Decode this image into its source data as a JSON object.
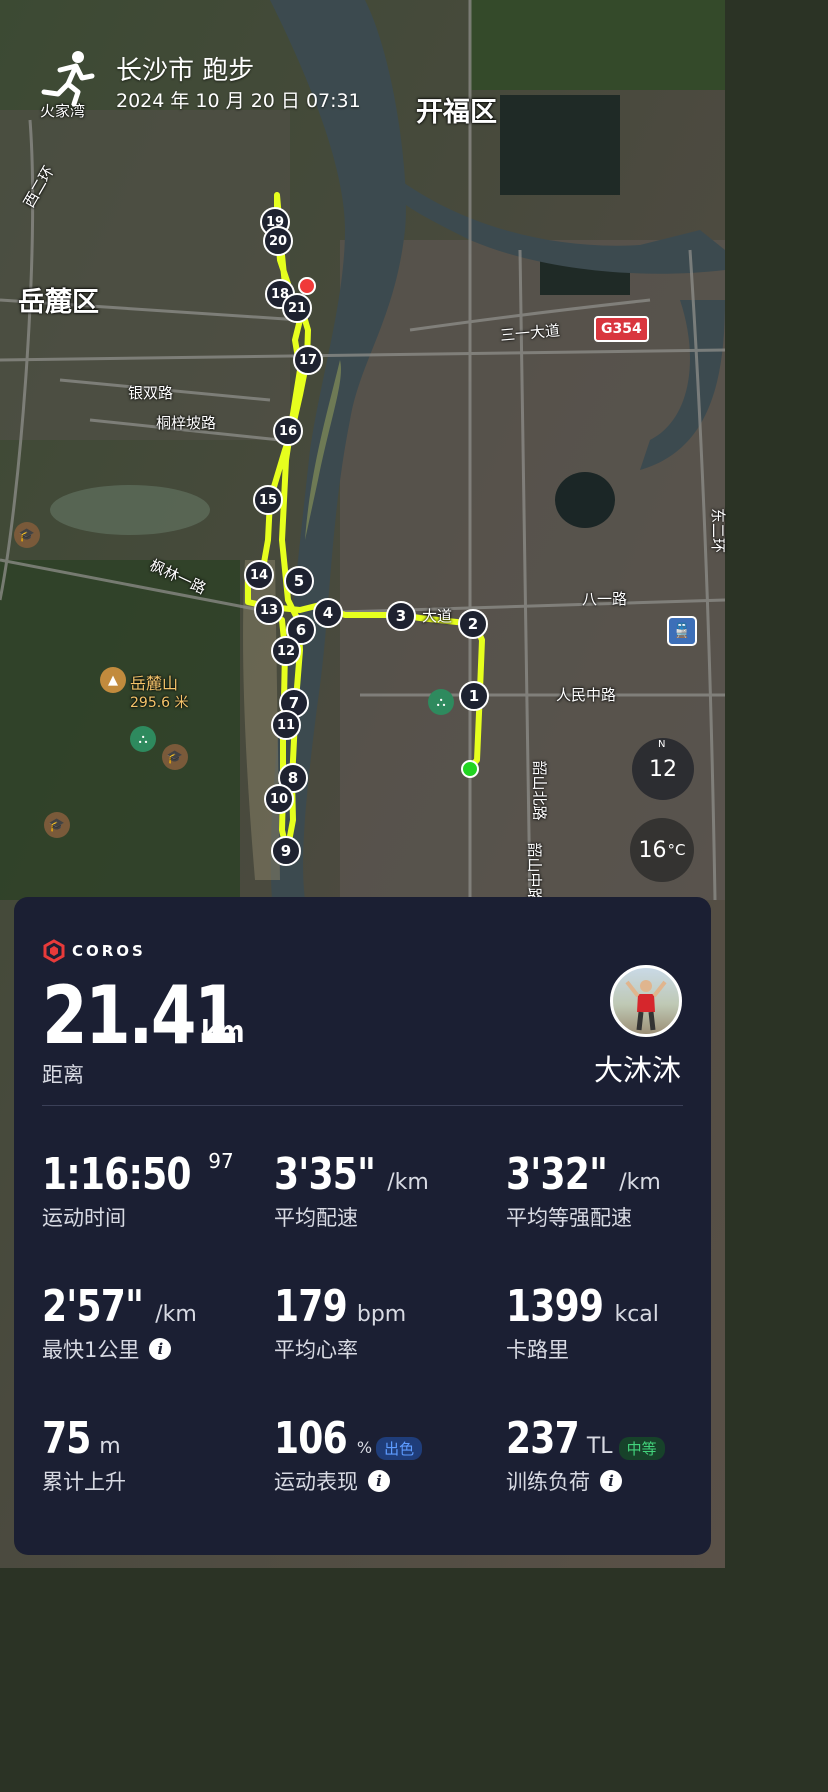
{
  "header": {
    "title": "长沙市 跑步",
    "date": "2024 年 10 月 20 日 07:31"
  },
  "map_labels": {
    "district_kaifu": "开福区",
    "district_yuelu": "岳麓区",
    "huojiawan": "火家湾",
    "sanyi_road": "三一大道",
    "yinshuang_road": "银双路",
    "tongzipo_road": "桐梓坡路",
    "fenglin_road": "枫林一路",
    "bayi_road": "八一路",
    "renmin_road": "人民中路",
    "shaoshan_road": "韶山北路",
    "shaoshan_mid": "韶山中路",
    "yuelu_mountain": "岳麓山",
    "yuelu_height": "295.6 米",
    "dongerhuan": "东二环",
    "xierhuan": "西二环",
    "highway": "G354",
    "wuyi_road": "大道"
  },
  "route_markers": [
    "1",
    "2",
    "3",
    "4",
    "5",
    "6",
    "7",
    "8",
    "9",
    "10",
    "11",
    "12",
    "13",
    "14",
    "15",
    "16",
    "17",
    "18",
    "19",
    "20",
    "21"
  ],
  "map_widgets": {
    "compass_value": "12",
    "compass_north": "N",
    "temperature": "16",
    "temperature_unit": "°C"
  },
  "card": {
    "brand": "COROS",
    "distance_value": "21.41",
    "distance_unit": "km",
    "distance_label": "距离",
    "username": "大沐沐",
    "stats": {
      "time": {
        "value": "1:16:50",
        "sup": "97",
        "label": "运动时间"
      },
      "avg_pace": {
        "value": "3'35\"",
        "unit": "/km",
        "label": "平均配速"
      },
      "avg_grade_pace": {
        "value": "3'32\"",
        "unit": "/km",
        "label": "平均等强配速"
      },
      "fastest_km": {
        "value": "2'57\"",
        "unit": "/km",
        "label": "最快1公里"
      },
      "avg_hr": {
        "value": "179",
        "unit": "bpm",
        "label": "平均心率"
      },
      "calories": {
        "value": "1399",
        "unit": "kcal",
        "label": "卡路里"
      },
      "elevation": {
        "value": "75",
        "unit": "m",
        "label": "累计上升"
      },
      "performance": {
        "value": "106",
        "unit": "%",
        "tag": "出色",
        "label": "运动表现"
      },
      "training_load": {
        "value": "237",
        "unit": "TL",
        "tag": "中等",
        "label": "训练负荷"
      }
    },
    "info_glyph": "i"
  },
  "colors": {
    "route": "#e6ff1e",
    "card_bg": "#1b1f33",
    "tag_excellent_bg": "#1f3d7a",
    "tag_excellent_fg": "#5d9bff",
    "tag_medium_bg": "#17422a",
    "tag_medium_fg": "#42d27b",
    "start_dot": "#22d422",
    "end_dot": "#f03a3a"
  }
}
